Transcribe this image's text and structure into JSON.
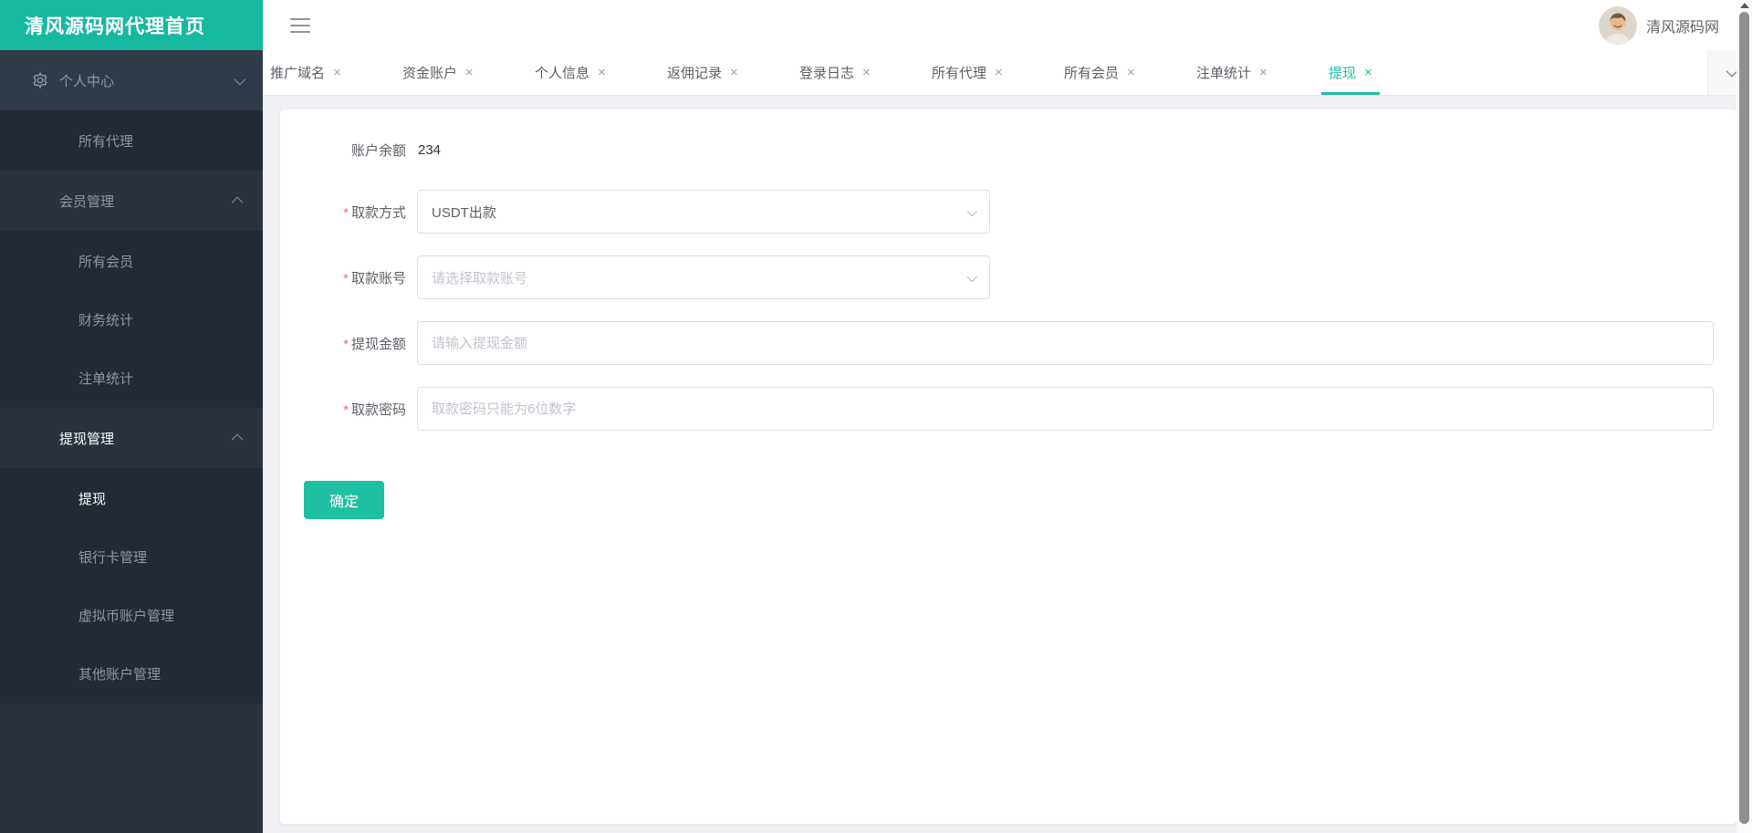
{
  "accent_color": "#17b8a0",
  "logo": {
    "title": "清风源码网代理首页"
  },
  "topbar": {
    "user_name": "清风源码网"
  },
  "sidebar": {
    "items": [
      {
        "label": "个人中心",
        "type": "parent",
        "icon": "gear-icon",
        "chevron": "down"
      },
      {
        "label": "所有代理",
        "type": "sub"
      },
      {
        "label": "会员管理",
        "type": "parent",
        "chevron": "up"
      },
      {
        "label": "所有会员",
        "type": "sub"
      },
      {
        "label": "财务统计",
        "type": "sub"
      },
      {
        "label": "注单统计",
        "type": "sub"
      },
      {
        "label": "提现管理",
        "type": "parent",
        "chevron": "up",
        "active": true
      },
      {
        "label": "提现",
        "type": "sub",
        "active": true
      },
      {
        "label": "银行卡管理",
        "type": "sub"
      },
      {
        "label": "虚拟币账户管理",
        "type": "sub"
      },
      {
        "label": "其他账户管理",
        "type": "sub"
      }
    ]
  },
  "tabs": {
    "close_glyph": "×",
    "items": [
      {
        "label": "推广域名"
      },
      {
        "label": "资金账户"
      },
      {
        "label": "个人信息"
      },
      {
        "label": "返佣记录"
      },
      {
        "label": "登录日志"
      },
      {
        "label": "所有代理"
      },
      {
        "label": "所有会员"
      },
      {
        "label": "注单统计"
      },
      {
        "label": "提现",
        "active": true
      }
    ]
  },
  "form": {
    "required_mark": "*",
    "balance_label": "账户余额",
    "balance_value": "234",
    "rows": [
      {
        "label": "取款方式",
        "type": "select",
        "value": "USDT出款"
      },
      {
        "label": "取款账号",
        "type": "select",
        "placeholder": "请选择取款账号"
      },
      {
        "label": "提现金额",
        "type": "input",
        "placeholder": "请输入提现金额"
      },
      {
        "label": "取款密码",
        "type": "input",
        "placeholder": "取款密码只能为6位数字"
      }
    ],
    "submit_label": "确定"
  }
}
